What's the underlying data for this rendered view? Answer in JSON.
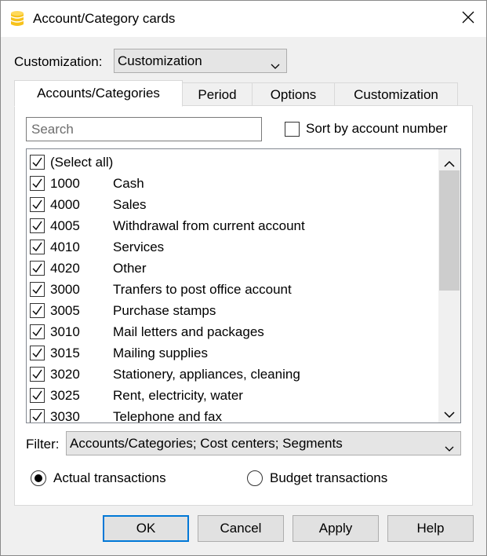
{
  "window": {
    "title": "Account/Category cards"
  },
  "customization": {
    "label": "Customization:",
    "value": "Customization"
  },
  "tabs": [
    {
      "label": "Accounts/Categories",
      "active": true
    },
    {
      "label": "Period",
      "active": false
    },
    {
      "label": "Options",
      "active": false
    },
    {
      "label": "Customization",
      "active": false
    }
  ],
  "search": {
    "placeholder": "Search",
    "value": ""
  },
  "sort": {
    "label": "Sort by account number",
    "checked": false
  },
  "list": {
    "select_all": {
      "label": "(Select all)",
      "checked": true
    },
    "items": [
      {
        "number": "1000",
        "name": "Cash",
        "checked": true
      },
      {
        "number": "4000",
        "name": "Sales",
        "checked": true
      },
      {
        "number": "4005",
        "name": "Withdrawal from current account",
        "checked": true
      },
      {
        "number": "4010",
        "name": "Services",
        "checked": true
      },
      {
        "number": "4020",
        "name": "Other",
        "checked": true
      },
      {
        "number": "3000",
        "name": "Tranfers to post office account",
        "checked": true
      },
      {
        "number": "3005",
        "name": "Purchase stamps",
        "checked": true
      },
      {
        "number": "3010",
        "name": "Mail letters and packages",
        "checked": true
      },
      {
        "number": "3015",
        "name": "Mailing supplies",
        "checked": true
      },
      {
        "number": "3020",
        "name": "Stationery, appliances, cleaning",
        "checked": true
      },
      {
        "number": "3025",
        "name": "Rent, electricity, water",
        "checked": true
      },
      {
        "number": "3030",
        "name": "Telephone and fax",
        "checked": true
      }
    ]
  },
  "filter": {
    "label": "Filter:",
    "value": "Accounts/Categories; Cost centers; Segments"
  },
  "transactions": {
    "actual": {
      "label": "Actual transactions",
      "selected": true
    },
    "budget": {
      "label": "Budget transactions",
      "selected": false
    }
  },
  "buttons": {
    "ok": "OK",
    "cancel": "Cancel",
    "apply": "Apply",
    "help": "Help"
  },
  "colors": {
    "accent": "#0078d7",
    "app_icon": "#f7c21b"
  }
}
